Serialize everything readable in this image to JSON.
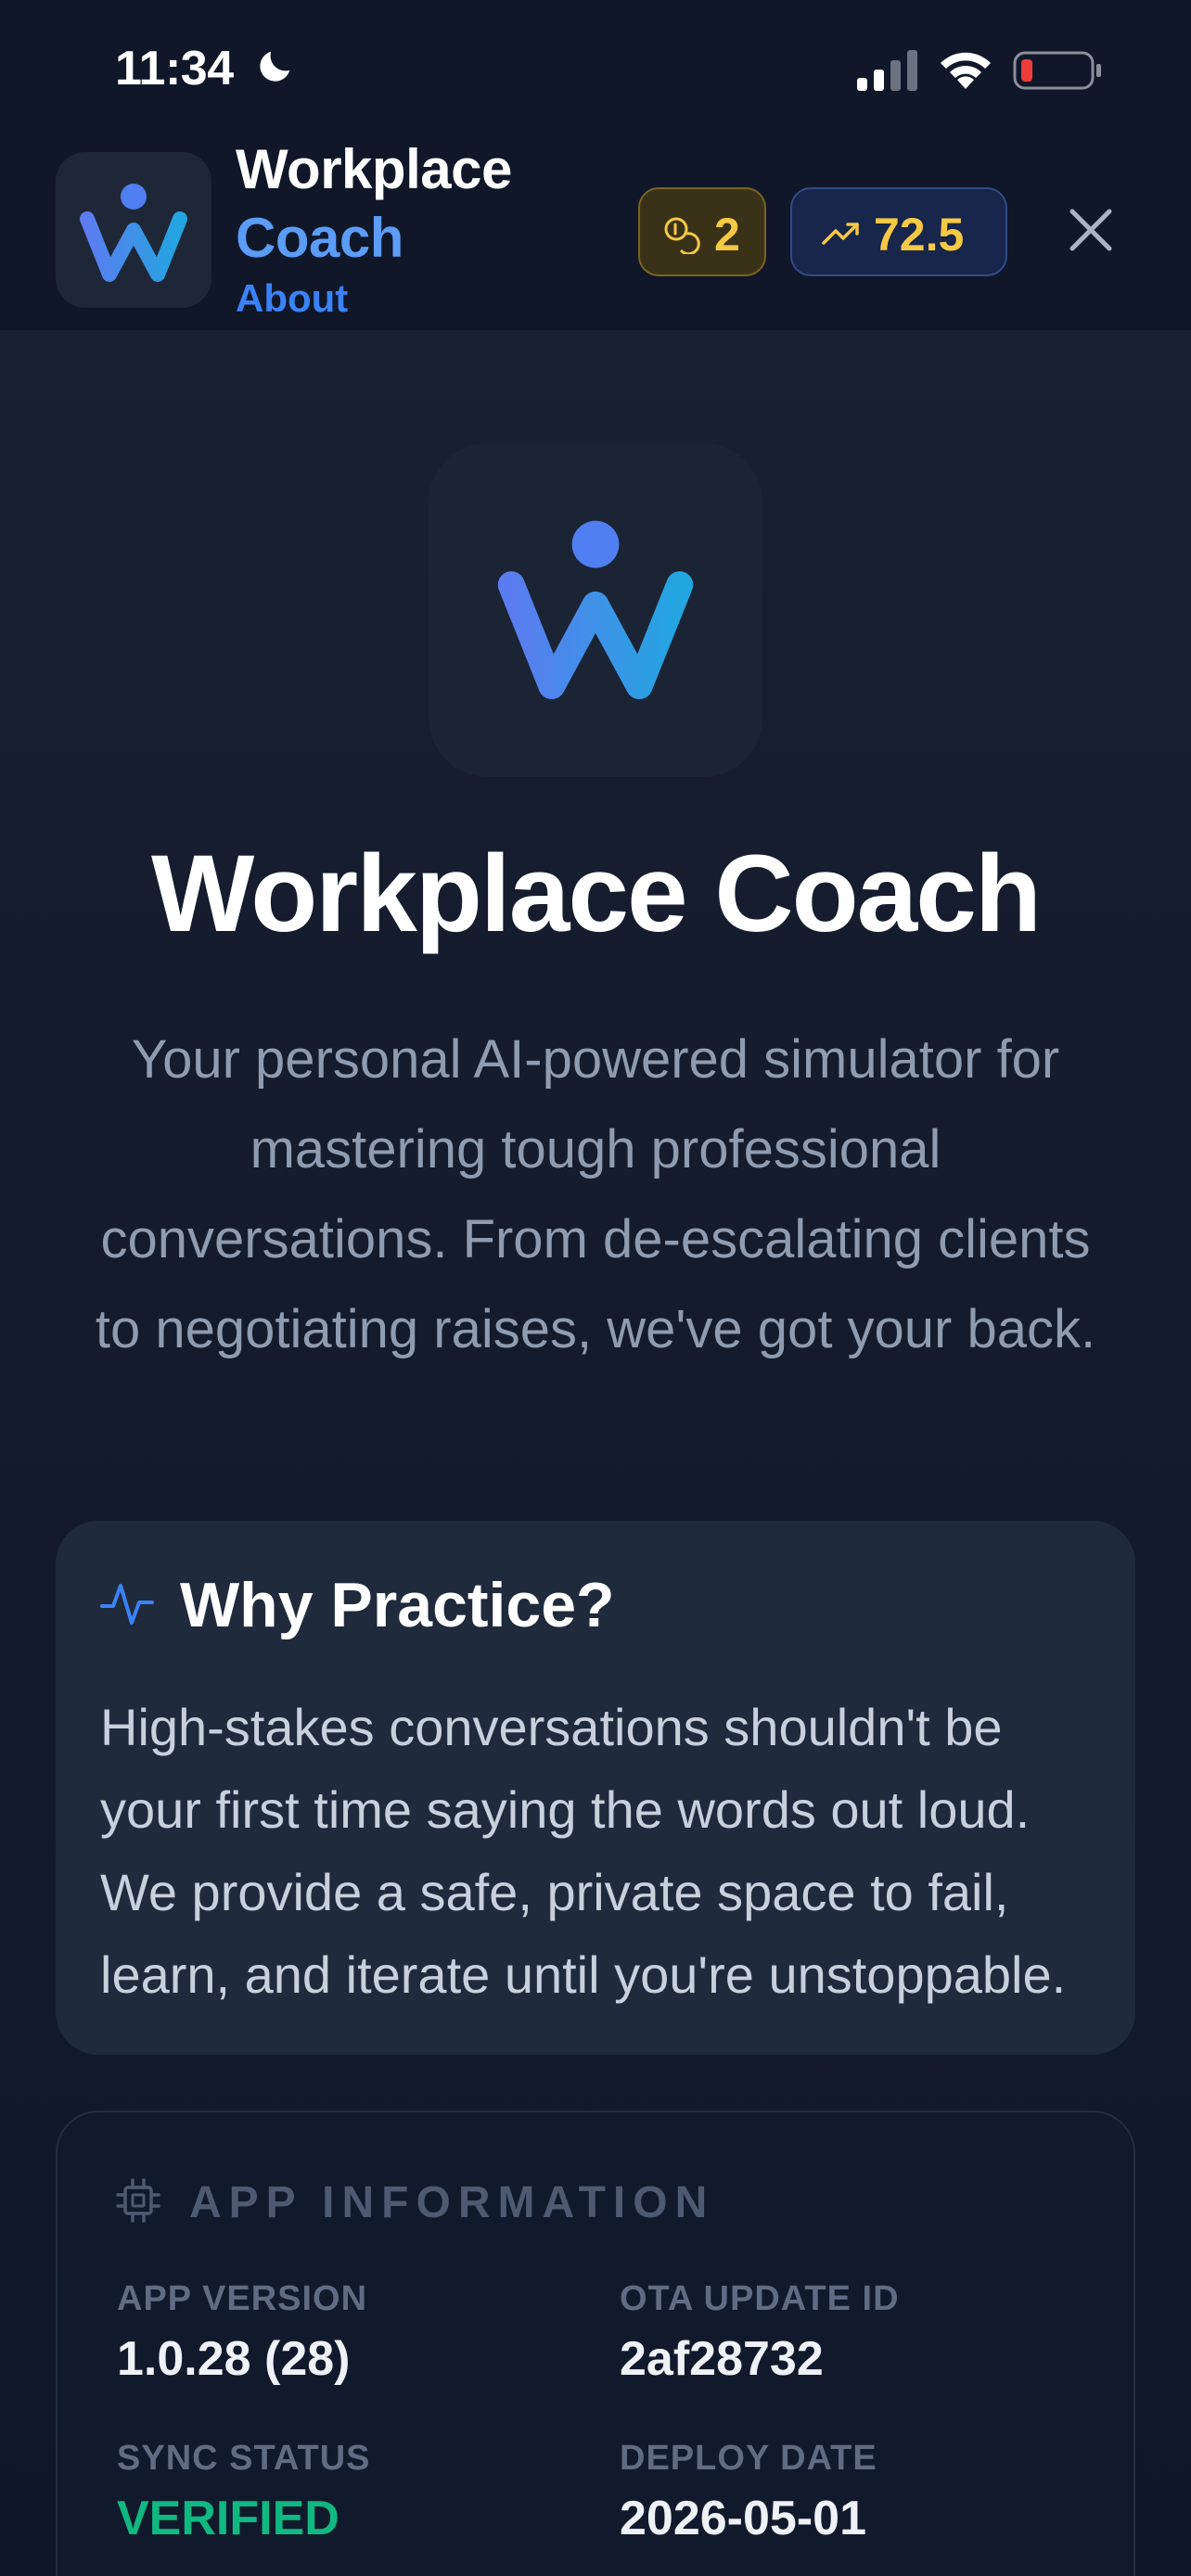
{
  "status_bar": {
    "time": "11:34",
    "moon_icon": "moon-icon",
    "signal_icon": "cellular-signal-icon",
    "wifi_icon": "wifi-icon",
    "battery_icon": "battery-low-icon"
  },
  "header": {
    "logo_icon": "workplace-coach-logo",
    "title_line1": "Workplace",
    "title_line2": "Coach",
    "subtitle": "About",
    "coins": {
      "icon": "coins-icon",
      "value": "2"
    },
    "score": {
      "icon": "trending-up-icon",
      "value": "72.5"
    },
    "close_icon": "close-icon"
  },
  "hero": {
    "logo_icon": "workplace-coach-logo",
    "title": "Workplace Coach",
    "description": "Your personal AI-powered simulator for mastering tough professional conversations. From de-escalating clients to negotiating raises, we've got your back."
  },
  "why_practice": {
    "icon": "activity-pulse-icon",
    "title": "Why Practice?",
    "body": "High-stakes conversations shouldn't be your first time saying the words out loud. We provide a safe, private space to fail, learn, and iterate until you're unstoppable."
  },
  "app_info": {
    "icon": "cpu-chip-icon",
    "title": "APP INFORMATION",
    "fields": [
      {
        "label": "APP VERSION",
        "value": "1.0.28 (28)"
      },
      {
        "label": "OTA UPDATE ID",
        "value": "2af28732"
      },
      {
        "label": "SYNC STATUS",
        "value": "VERIFIED"
      },
      {
        "label": "DEPLOY DATE",
        "value": "2026-05-01"
      }
    ]
  },
  "colors": {
    "accent_blue": "#3b82f6",
    "coin_gold": "#f6c945",
    "verified_green": "#10b981",
    "background": "#131b2d"
  }
}
